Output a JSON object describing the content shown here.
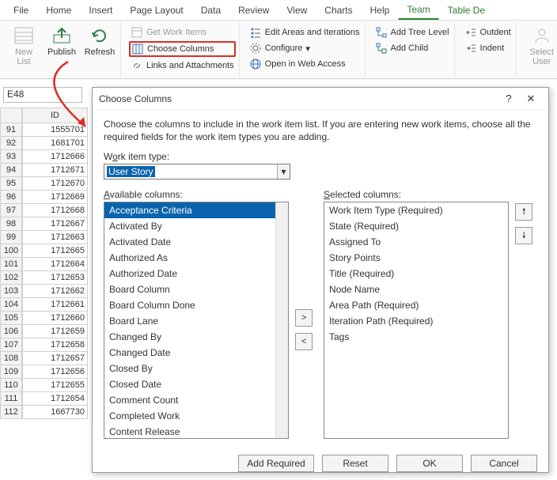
{
  "tabs": [
    "File",
    "Home",
    "Insert",
    "Page Layout",
    "Data",
    "Review",
    "View",
    "Charts",
    "Help",
    "Team",
    "Table De"
  ],
  "activeTab": 9,
  "ribbon": {
    "newList": "New\nList",
    "publish": "Publish",
    "refresh": "Refresh",
    "getWorkItems": "Get Work Items",
    "chooseColumns": "Choose Columns",
    "linksAttach": "Links and Attachments",
    "editAreas": "Edit Areas and Iterations",
    "configure": "Configure",
    "openWeb": "Open in Web Access",
    "addTree": "Add Tree Level",
    "addChild": "Add Child",
    "outdent": "Outdent",
    "indent": "Indent",
    "selectUser": "Select\nUser"
  },
  "nameBox": "E48",
  "columnHeader": "ID",
  "rows": [
    {
      "n": 91,
      "id": 1555701
    },
    {
      "n": 92,
      "id": 1681701
    },
    {
      "n": 93,
      "id": 1712666
    },
    {
      "n": 94,
      "id": 1712671
    },
    {
      "n": 95,
      "id": 1712670
    },
    {
      "n": 96,
      "id": 1712669
    },
    {
      "n": 97,
      "id": 1712668
    },
    {
      "n": 98,
      "id": 1712667
    },
    {
      "n": 99,
      "id": 1712663
    },
    {
      "n": 100,
      "id": 1712665
    },
    {
      "n": 101,
      "id": 1712664
    },
    {
      "n": 102,
      "id": 1712653
    },
    {
      "n": 103,
      "id": 1712662
    },
    {
      "n": 104,
      "id": 1712661
    },
    {
      "n": 105,
      "id": 1712660
    },
    {
      "n": 106,
      "id": 1712659
    },
    {
      "n": 107,
      "id": 1712658
    },
    {
      "n": 108,
      "id": 1712657
    },
    {
      "n": 109,
      "id": 1712656
    },
    {
      "n": 110,
      "id": 1712655
    },
    {
      "n": 111,
      "id": 1712654
    },
    {
      "n": 112,
      "id": 1667730
    }
  ],
  "dialog": {
    "title": "Choose Columns",
    "desc": "Choose the columns to include in the work item list.  If you are entering new work items, choose all the required fields for the work item types you are adding.",
    "workItemTypeLabel": {
      "pre": "W",
      "u": "o",
      "post": "rk item type:"
    },
    "workItemType": "User Story",
    "availLabel": {
      "pre": "",
      "u": "A",
      "post": "vailable columns:"
    },
    "selLabel": {
      "pre": "",
      "u": "S",
      "post": "elected columns:"
    },
    "available": [
      "Acceptance Criteria",
      "Activated By",
      "Activated Date",
      "Authorized As",
      "Authorized Date",
      "Board Column",
      "Board Column Done",
      "Board Lane",
      "Changed By",
      "Changed Date",
      "Closed By",
      "Closed Date",
      "Comment Count",
      "Completed Work",
      "Content Release"
    ],
    "selected": [
      "Work Item Type (Required)",
      "State (Required)",
      "Assigned To",
      "Story Points",
      "Title (Required)",
      "Node Name",
      "Area Path (Required)",
      "Iteration Path (Required)",
      "Tags"
    ],
    "buttons": {
      "addReq": "Add Required",
      "reset": "Reset",
      "ok": "OK",
      "cancel": "Cancel"
    }
  }
}
